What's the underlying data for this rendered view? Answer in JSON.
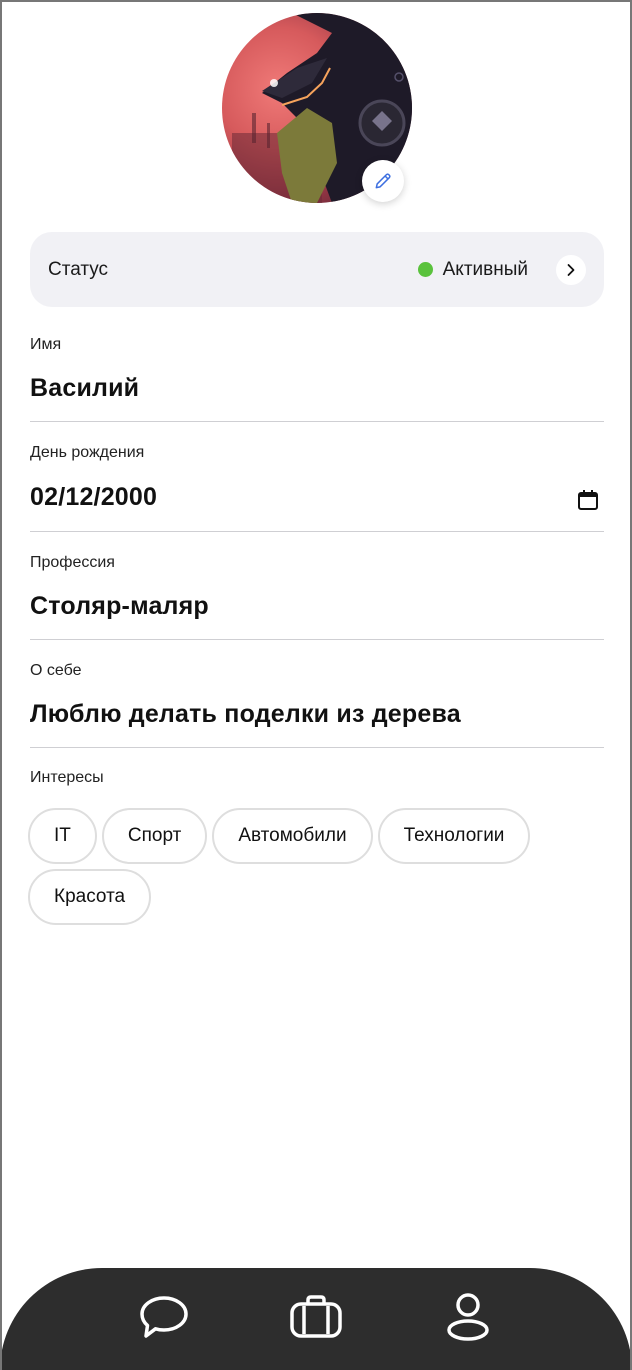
{
  "profile": {
    "avatar_alt": "avatar",
    "status": {
      "label": "Статус",
      "value": "Активный",
      "indicator_color": "#5ac23c"
    },
    "fields": {
      "name": {
        "label": "Имя",
        "value": "Василий"
      },
      "birthday": {
        "label": "День рождения",
        "value": "02/12/2000"
      },
      "profession": {
        "label": "Профессия",
        "value": "Столяр-маляр"
      },
      "about": {
        "label": "О себе",
        "value": "Люблю делать поделки из дерева"
      }
    },
    "interests": {
      "label": "Интересы",
      "items": [
        "IT",
        "Спорт",
        "Автомобили",
        "Технологии",
        "Красота"
      ]
    }
  },
  "nav": {
    "items": [
      {
        "icon": "chat-icon"
      },
      {
        "icon": "briefcase-icon"
      },
      {
        "icon": "profile-icon"
      }
    ]
  },
  "colors": {
    "accent": "#3d6fe0",
    "nav_bg": "#2d2d2d",
    "card_bg": "#f1f1f5"
  }
}
